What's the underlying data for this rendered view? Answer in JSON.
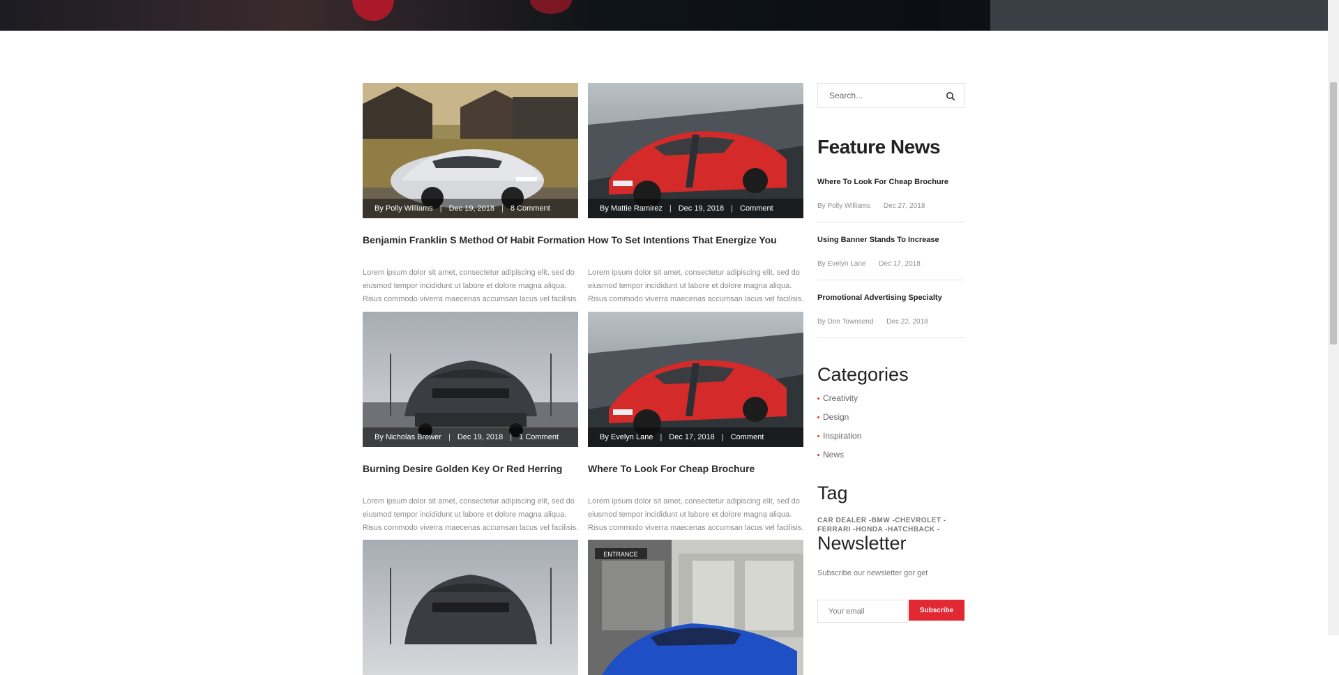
{
  "posts": [
    {
      "author": "By Polly Williams",
      "date": "Dec 19, 2018",
      "comments": "8 Comment",
      "title": "Benjamin Franklin S Method Of Habit Formation",
      "excerpt": "Lorem ipsum dolor sit amet, consectetur adipiscing elit, sed do eiusmod tempor incididunt ut labore et dolore magna aliqua. Risus commodo viverra maecenas accumsan lacus vel facilisis."
    },
    {
      "author": "By Mattie Ramirez",
      "date": "Dec 19, 2018",
      "comments": "Comment",
      "title": "How To Set Intentions That Energize You",
      "excerpt": "Lorem ipsum dolor sit amet, consectetur adipiscing elit, sed do eiusmod tempor incididunt ut labore et dolore magna aliqua. Risus commodo viverra maecenas accumsan lacus vel facilisis."
    },
    {
      "author": "By Nicholas Brewer",
      "date": "Dec 19, 2018",
      "comments": "1 Comment",
      "title": "Burning Desire Golden Key Or Red Herring",
      "excerpt": "Lorem ipsum dolor sit amet, consectetur adipiscing elit, sed do eiusmod tempor incididunt ut labore et dolore magna aliqua. Risus commodo viverra maecenas accumsan lacus vel facilisis."
    },
    {
      "author": "By Evelyn Lane",
      "date": "Dec 17, 2018",
      "comments": "Comment",
      "title": "Where To Look For Cheap Brochure",
      "excerpt": "Lorem ipsum dolor sit amet, consectetur adipiscing elit, sed do eiusmod tempor incididunt ut labore et dolore magna aliqua. Risus commodo viverra maecenas accumsan lacus vel facilisis."
    }
  ],
  "bottom_photos": {
    "entrance_sign": "ENTRANCE"
  },
  "search": {
    "placeholder": "Search..."
  },
  "feature_news": {
    "heading": "Feature News",
    "items": [
      {
        "title": "Where To Look For Cheap Brochure",
        "author": "By Polly Williams",
        "date": "Dec 27, 2018"
      },
      {
        "title": "Using Banner Stands To Increase",
        "author": "By Evelyn Lane",
        "date": "Dec 17, 2018"
      },
      {
        "title": "Promotional Advertising Specialty",
        "author": "By Don Townsend",
        "date": "Dec 22, 2018"
      }
    ]
  },
  "categories": {
    "heading": "Categories",
    "items": [
      "Creativity",
      "Design",
      "Inspiration",
      "News"
    ]
  },
  "tags": {
    "heading": "Tag",
    "items": [
      "CAR DEALER",
      "-BMW",
      "-CHEVROLET",
      "-",
      "FERRARI",
      "-HONDA",
      "-HATCHBACK",
      "-"
    ]
  },
  "newsletter": {
    "heading": "Newsletter",
    "text": "Subscribe our newsletter gor get",
    "placeholder": "Your email",
    "button": "Subscribe"
  },
  "colors": {
    "accent": "#e22833",
    "title": "#2a2a2a",
    "muted": "#8a8a8a"
  }
}
